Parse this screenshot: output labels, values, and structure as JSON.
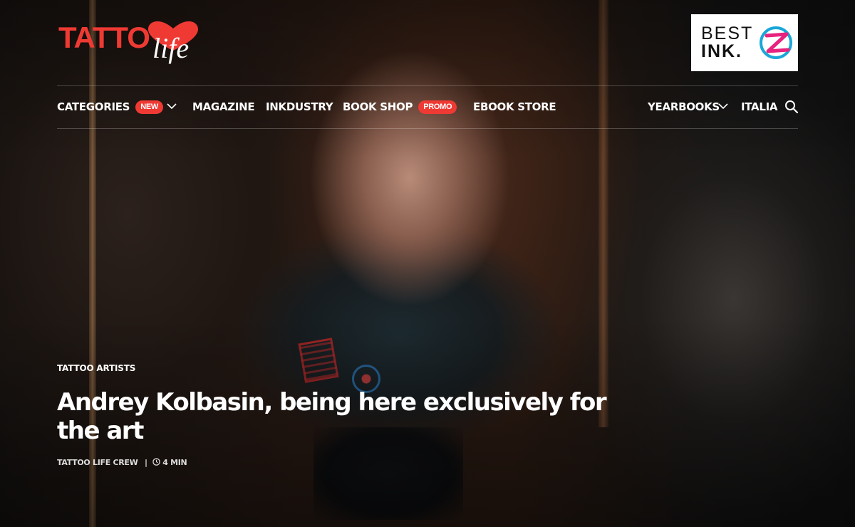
{
  "brand": {
    "logo_main": "TATTO",
    "logo_sub": "life",
    "accent_color": "#ef3a34"
  },
  "ad": {
    "line1": "BEST",
    "line2": "INK.",
    "mark_icon": "z-logo-icon"
  },
  "nav": {
    "left": [
      {
        "label": "CATEGORIES",
        "badge": "NEW",
        "dropdown": true
      },
      {
        "label": "MAGAZINE"
      },
      {
        "label": "INKDUSTRY"
      },
      {
        "label": "BOOK SHOP",
        "badge": "PROMO"
      },
      {
        "label": "EBOOK STORE"
      }
    ],
    "right": [
      {
        "label": "YEARBOOKS",
        "dropdown": true
      },
      {
        "label": "ITALIA"
      }
    ],
    "search_icon": "search-icon",
    "dropdown_icon": "chevron-down-icon"
  },
  "article": {
    "category": "TATTOO ARTISTS",
    "title": "Andrey Kolbasin, being here exclusively for the art",
    "author": "TATTOO LIFE CREW",
    "separator": "|",
    "read_time": "4 MIN",
    "clock_icon": "clock-icon"
  }
}
